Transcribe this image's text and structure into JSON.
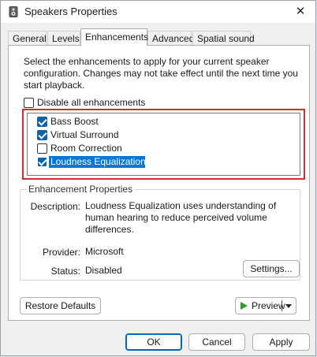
{
  "window": {
    "title": "Speakers Properties",
    "close_glyph": "✕"
  },
  "tabs": [
    {
      "label": "General",
      "active": false
    },
    {
      "label": "Levels",
      "active": false
    },
    {
      "label": "Enhancements",
      "active": true
    },
    {
      "label": "Advanced",
      "active": false
    },
    {
      "label": "Spatial sound",
      "active": false
    }
  ],
  "enhancements": {
    "intro": "Select the enhancements to apply for your current speaker configuration. Changes may not take effect until the next time you start playback.",
    "disable_all": {
      "label": "Disable all enhancements",
      "checked": false
    },
    "items": [
      {
        "label": "Bass Boost",
        "checked": true,
        "selected": false
      },
      {
        "label": "Virtual Surround",
        "checked": true,
        "selected": false
      },
      {
        "label": "Room Correction",
        "checked": false,
        "selected": false
      },
      {
        "label": "Loudness Equalization",
        "checked": true,
        "selected": true
      }
    ]
  },
  "properties": {
    "group_title": "Enhancement Properties",
    "description_label": "Description:",
    "description_value": "Loudness Equalization uses understanding of human hearing to reduce perceived volume differences.",
    "provider_label": "Provider:",
    "provider_value": "Microsoft",
    "status_label": "Status:",
    "status_value": "Disabled",
    "settings_button": "Settings..."
  },
  "buttons": {
    "restore_defaults": "Restore Defaults",
    "preview": "Preview",
    "ok": "OK",
    "cancel": "Cancel",
    "apply": "Apply"
  },
  "colors": {
    "selection": "#0078d7",
    "checkbox_checked": "#0f62a8",
    "highlight_frame": "#cf2c2c",
    "play_icon": "#2c9e2c"
  },
  "icons": {
    "title": "speaker-icon",
    "close": "close-icon",
    "preview": "play-icon",
    "dropdown": "chevron-down-icon"
  }
}
